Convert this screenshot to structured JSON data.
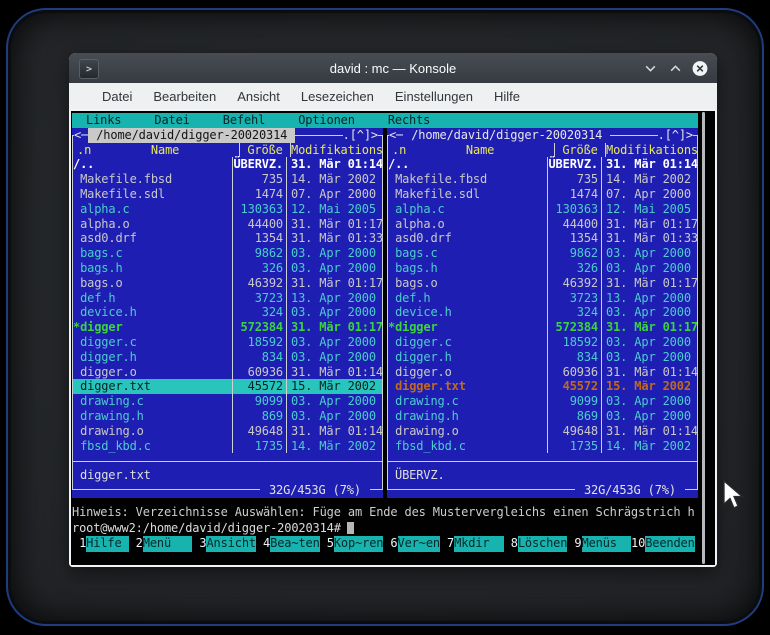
{
  "window": {
    "title": "david : mc — Konsole",
    "app_icon": ">",
    "controls": [
      "minimize",
      "maximize",
      "close"
    ]
  },
  "menubar": {
    "items": [
      "Datei",
      "Bearbeiten",
      "Ansicht",
      "Lesezeichen",
      "Einstellungen",
      "Hilfe"
    ]
  },
  "mc": {
    "menu": [
      "Links",
      "Datei",
      "Befehl",
      "Optionen",
      "Rechts"
    ],
    "panel_path": " /home/david/digger-20020314 ",
    "arrow_label": "<─",
    "corner_label": ".[^]>",
    "headers": {
      "sort": ".n",
      "name": "Name",
      "size": "Größe",
      "date": "Modifikations"
    },
    "rows": [
      {
        "name": "/..",
        "size": "ÜBERVZ.",
        "date": "31. Mär 01:14",
        "type": "updir"
      },
      {
        "name": " Makefile.fbsd",
        "size": "735",
        "date": "14. Mär 2002",
        "type": "plain"
      },
      {
        "name": " Makefile.sdl",
        "size": "1474",
        "date": "07. Apr 2000",
        "type": "plain"
      },
      {
        "name": " alpha.c",
        "size": "130363",
        "date": "12. Mai 2005",
        "type": "src"
      },
      {
        "name": " alpha.o",
        "size": "44400",
        "date": "31. Mär 01:17",
        "type": "plain"
      },
      {
        "name": " asd0.drf",
        "size": "1354",
        "date": "31. Mär 01:33",
        "type": "plain"
      },
      {
        "name": " bags.c",
        "size": "9862",
        "date": "03. Apr 2000",
        "type": "src"
      },
      {
        "name": " bags.h",
        "size": "326",
        "date": "03. Apr 2000",
        "type": "src"
      },
      {
        "name": " bags.o",
        "size": "46392",
        "date": "31. Mär 01:17",
        "type": "plain"
      },
      {
        "name": " def.h",
        "size": "3723",
        "date": "13. Apr 2000",
        "type": "src"
      },
      {
        "name": " device.h",
        "size": "324",
        "date": "03. Apr 2000",
        "type": "src"
      },
      {
        "name": "*digger",
        "size": "572384",
        "date": "31. Mär 01:17",
        "type": "exec"
      },
      {
        "name": " digger.c",
        "size": "18592",
        "date": "03. Apr 2000",
        "type": "src"
      },
      {
        "name": " digger.h",
        "size": "834",
        "date": "03. Apr 2000",
        "type": "src"
      },
      {
        "name": " digger.o",
        "size": "60936",
        "date": "31. Mär 01:14",
        "type": "plain"
      },
      {
        "name": " digger.txt",
        "size": "45572",
        "date": "15. Mär 2002",
        "type": "plain"
      },
      {
        "name": " drawing.c",
        "size": "9099",
        "date": "03. Apr 2000",
        "type": "src"
      },
      {
        "name": " drawing.h",
        "size": "869",
        "date": "03. Apr 2000",
        "type": "src"
      },
      {
        "name": " drawing.o",
        "size": "49648",
        "date": "31. Mär 01:14",
        "type": "plain"
      },
      {
        "name": " fbsd_kbd.c",
        "size": "1735",
        "date": "14. Mär 2002",
        "type": "src"
      }
    ],
    "left_panel": {
      "mini": "digger.txt",
      "info": " 32G/453G (7%) ",
      "selected_index": 15,
      "path_active": true
    },
    "right_panel": {
      "mini": "ÜBERVZ.",
      "info": " 32G/453G (7%) ",
      "marked_index": 15,
      "path_active": false
    },
    "hint": "Hinweis: Verzeichnisse Auswählen: Füge am Ende des Mustervergleichs einen Schrägstrich h",
    "prompt": "root@www2:/home/david/digger-20020314#",
    "fkeys": [
      {
        "num": " 1",
        "label": "Hilfe "
      },
      {
        "num": " 2",
        "label": "Menü   "
      },
      {
        "num": " 3",
        "label": "Ansicht"
      },
      {
        "num": " 4",
        "label": "Bea~ten"
      },
      {
        "num": " 5",
        "label": "Kop~ren"
      },
      {
        "num": " 6",
        "label": "Ver~en"
      },
      {
        "num": " 7",
        "label": "Mkdir  "
      },
      {
        "num": " 8",
        "label": "Löschen"
      },
      {
        "num": " 9",
        "label": "Menüs  "
      },
      {
        "num": "10",
        "label": "Beenden"
      }
    ]
  },
  "colors": {
    "panel_blue": "#1e1fb2",
    "cyan": "#17b3af",
    "selection": "#29c5bd",
    "source_file": "#4ccccc",
    "executable": "#3cd43c",
    "marked": "#c2691c",
    "header_yellow": "#e8e85c",
    "frame": "#ccd1d4",
    "titlebar": "#3d4248",
    "menubar_bg": "#eff0f1"
  }
}
